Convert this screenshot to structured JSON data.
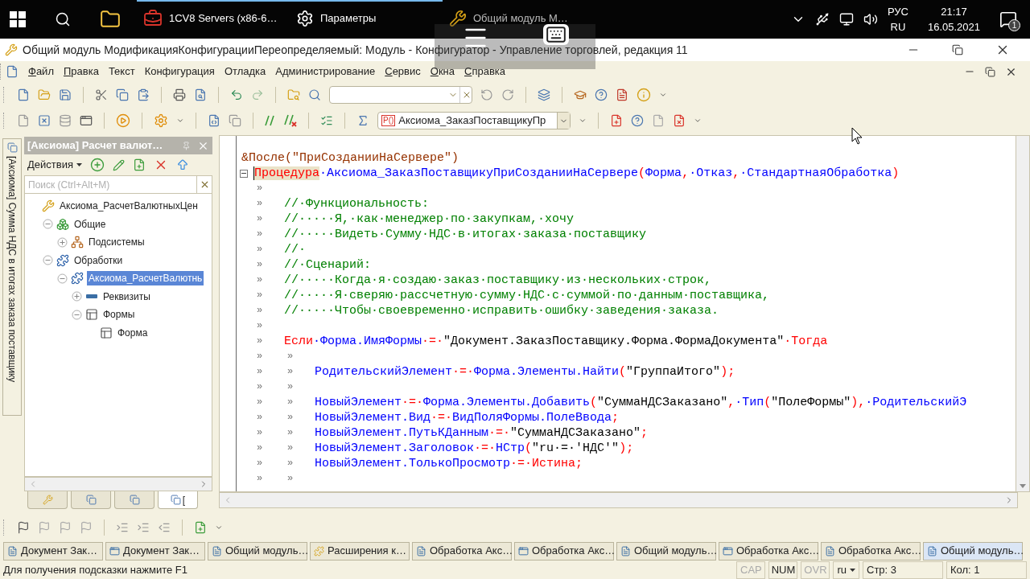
{
  "taskbar": {
    "apps": [
      {
        "kind": "servers",
        "label": "1CV8 Servers (x86-6…",
        "running": true
      },
      {
        "kind": "settings",
        "label": "Параметры",
        "running": true
      },
      {
        "kind": "onec",
        "label": "Общий модуль М…",
        "running": false
      }
    ],
    "tray": {
      "lang_top": "РУС",
      "lang_bottom": "RU",
      "time": "21:17",
      "date": "16.05.2021",
      "notifications": "1"
    }
  },
  "window": {
    "title": "Общий модуль МодификацияКонфигурацииПереопределяемый: Модуль - Конфигуратор - Управление торговлей, редакция 11"
  },
  "menu": [
    {
      "label": "Файл",
      "accel": true
    },
    {
      "label": "Правка",
      "accel": true
    },
    {
      "label": "Текст",
      "accel": false
    },
    {
      "label": "Конфигурация",
      "accel": false
    },
    {
      "label": "Отладка",
      "accel": false
    },
    {
      "label": "Администрирование",
      "accel": false
    },
    {
      "label": "Сервис",
      "accel": true
    },
    {
      "label": "Окна",
      "accel": true
    },
    {
      "label": "Справка",
      "accel": true
    }
  ],
  "procedure_selector": {
    "value": "Аксиома_ЗаказПоставщикуПр",
    "badge": "P()"
  },
  "side_tab": {
    "label": "[Аксиома] Сумма НДС в итогах заказа поставщику"
  },
  "panel": {
    "title": "[Аксиома] Расчет валют…",
    "actions": "Действия",
    "search": {
      "placeholder": "Поиск (Ctrl+Alt+M)"
    },
    "tree": [
      {
        "label": "Аксиома_РасчетВалютныхЦен",
        "kind": "configuration",
        "selected": false,
        "children": [
          {
            "label": "Общие",
            "kind": "common",
            "expanded": true,
            "selected": false,
            "children": [
              {
                "label": "Подсистемы",
                "kind": "subsystems",
                "expanded": false,
                "selected": false
              }
            ]
          },
          {
            "label": "Обработки",
            "kind": "processors",
            "expanded": true,
            "selected": false,
            "children": [
              {
                "label": "Аксиома_РасчетВалютнь",
                "kind": "processor",
                "expanded": true,
                "selected": true,
                "children": [
                  {
                    "label": "Реквизиты",
                    "kind": "attributes",
                    "expanded": false,
                    "selected": false
                  },
                  {
                    "label": "Формы",
                    "kind": "forms",
                    "expanded": true,
                    "selected": false,
                    "children": [
                      {
                        "label": "Форма",
                        "kind": "form",
                        "selected": false
                      }
                    ]
                  }
                ]
              }
            ]
          }
        ]
      }
    ],
    "tabs": [
      {
        "selected": false
      },
      {
        "selected": false
      },
      {
        "selected": false
      },
      {
        "label": "[",
        "selected": true
      }
    ]
  },
  "code": [
    {
      "tokens": [
        {
          "kind": "directive",
          "text": "&После(\"ПриСозданииНаСервере\")"
        }
      ]
    },
    {
      "fold": true,
      "tokens": [
        {
          "kind": "keyword",
          "text": "Процедура",
          "highlight": true
        },
        {
          "kind": "ident",
          "text": "·Аксиома_ЗаказПоставщикуПриСозданииНаСервере"
        },
        {
          "kind": "op",
          "text": "("
        },
        {
          "kind": "ident",
          "text": "Форма"
        },
        {
          "kind": "op",
          "text": ","
        },
        {
          "kind": "ident",
          "text": "·Отказ"
        },
        {
          "kind": "op",
          "text": ","
        },
        {
          "kind": "ident",
          "text": "·СтандартнаяОбработка"
        },
        {
          "kind": "op",
          "text": ")"
        }
      ]
    },
    {
      "tabs": [
        "»"
      ]
    },
    {
      "tabs": [
        "»"
      ],
      "tokens": [
        {
          "kind": "comment",
          "text": "//·Функциональность:"
        }
      ]
    },
    {
      "tabs": [
        "»"
      ],
      "tokens": [
        {
          "kind": "comment",
          "text": "//·····Я,·как·менеджер·по·закупкам,·хочу"
        }
      ]
    },
    {
      "tabs": [
        "»"
      ],
      "tokens": [
        {
          "kind": "comment",
          "text": "//·····Видеть·Сумму·НДС·в·итогах·заказа·поставщику"
        }
      ]
    },
    {
      "tabs": [
        "»"
      ],
      "tokens": [
        {
          "kind": "comment",
          "text": "//·"
        }
      ]
    },
    {
      "tabs": [
        "»"
      ],
      "tokens": [
        {
          "kind": "comment",
          "text": "//·Сценарий:"
        }
      ]
    },
    {
      "tabs": [
        "»"
      ],
      "tokens": [
        {
          "kind": "comment",
          "text": "//·····Когда·я·создаю·заказ·поставщику·из·нескольких·строк,"
        }
      ]
    },
    {
      "tabs": [
        "»"
      ],
      "tokens": [
        {
          "kind": "comment",
          "text": "//·····Я·сверяю·рассчетную·сумму·НДС·с·суммой·по·данным·поставщика,"
        }
      ]
    },
    {
      "tabs": [
        "»"
      ],
      "tokens": [
        {
          "kind": "comment",
          "text": "//·····Чтобы·своевременно·исправить·ошибку·заведения·заказа."
        }
      ]
    },
    {
      "tabs": [
        "»"
      ]
    },
    {
      "tabs": [
        "»"
      ],
      "tokens": [
        {
          "kind": "keyword",
          "text": "Если"
        },
        {
          "kind": "ident",
          "text": "·Форма.ИмяФормы"
        },
        {
          "kind": "op",
          "text": "·=·"
        },
        {
          "kind": "string",
          "text": "\"Документ.ЗаказПоставщику.Форма.ФормаДокумента\""
        },
        {
          "kind": "keyword",
          "text": "·Тогда"
        }
      ]
    },
    {
      "tabs": [
        "»",
        "»"
      ]
    },
    {
      "tabs": [
        "»",
        "»"
      ],
      "tokens": [
        {
          "kind": "ident",
          "text": "РодительскийЭлемент"
        },
        {
          "kind": "op",
          "text": "·=·"
        },
        {
          "kind": "ident",
          "text": "Форма.Элементы.Найти"
        },
        {
          "kind": "op",
          "text": "("
        },
        {
          "kind": "string",
          "text": "\"ГруппаИтого\""
        },
        {
          "kind": "op",
          "text": ");"
        }
      ]
    },
    {
      "tabs": [
        "»",
        "»"
      ]
    },
    {
      "tabs": [
        "»",
        "»"
      ],
      "tokens": [
        {
          "kind": "ident",
          "text": "НовыйЭлемент"
        },
        {
          "kind": "op",
          "text": "·=·"
        },
        {
          "kind": "ident",
          "text": "Форма.Элементы.Добавить"
        },
        {
          "kind": "op",
          "text": "("
        },
        {
          "kind": "string",
          "text": "\"СуммаНДСЗаказано\""
        },
        {
          "kind": "op",
          "text": ","
        },
        {
          "kind": "ident",
          "text": "·Тип"
        },
        {
          "kind": "op",
          "text": "("
        },
        {
          "kind": "string",
          "text": "\"ПолеФормы\""
        },
        {
          "kind": "op",
          "text": "),"
        },
        {
          "kind": "ident",
          "text": "·РодительскийЭ"
        }
      ]
    },
    {
      "tabs": [
        "»",
        "»"
      ],
      "tokens": [
        {
          "kind": "ident",
          "text": "НовыйЭлемент.Вид"
        },
        {
          "kind": "op",
          "text": "·=·"
        },
        {
          "kind": "ident",
          "text": "ВидПоляФормы.ПолеВвода"
        },
        {
          "kind": "op",
          "text": ";"
        }
      ]
    },
    {
      "tabs": [
        "»",
        "»"
      ],
      "tokens": [
        {
          "kind": "ident",
          "text": "НовыйЭлемент.ПутьКДанным"
        },
        {
          "kind": "op",
          "text": "·=·"
        },
        {
          "kind": "string",
          "text": "\"СуммаНДСЗаказано\""
        },
        {
          "kind": "op",
          "text": ";"
        }
      ]
    },
    {
      "tabs": [
        "»",
        "»"
      ],
      "tokens": [
        {
          "kind": "ident",
          "text": "НовыйЭлемент.Заголовок"
        },
        {
          "kind": "op",
          "text": "·=·"
        },
        {
          "kind": "ident",
          "text": "НСтр"
        },
        {
          "kind": "op",
          "text": "("
        },
        {
          "kind": "string",
          "text": "\"ru·=·'НДС'\""
        },
        {
          "kind": "op",
          "text": ");"
        }
      ]
    },
    {
      "tabs": [
        "»",
        "»"
      ],
      "tokens": [
        {
          "kind": "ident",
          "text": "НовыйЭлемент.ТолькоПросмотр"
        },
        {
          "kind": "op",
          "text": "·=·"
        },
        {
          "kind": "keyword",
          "text": "Истина"
        },
        {
          "kind": "op",
          "text": ";"
        }
      ]
    },
    {
      "tabs": [
        "»",
        "»"
      ]
    }
  ],
  "window_tabs": [
    {
      "kind": "module",
      "label": "Документ Зак…",
      "selected": false
    },
    {
      "kind": "form",
      "label": "Документ Зак…",
      "selected": false
    },
    {
      "kind": "module",
      "label": "Общий модуль…",
      "selected": false
    },
    {
      "kind": "extension",
      "label": "Расширения к…",
      "selected": false
    },
    {
      "kind": "module",
      "label": "Обработка Акс…",
      "selected": false
    },
    {
      "kind": "form",
      "label": "Обработка Акс…",
      "selected": false
    },
    {
      "kind": "module",
      "label": "Общий модуль…",
      "selected": false
    },
    {
      "kind": "form",
      "label": "Обработка Акс…",
      "selected": false
    },
    {
      "kind": "module",
      "label": "Обработка Акс…",
      "selected": false
    },
    {
      "kind": "module",
      "label": "Общий модуль…",
      "selected": true
    }
  ],
  "status_bar": {
    "hint": "Для получения подсказки нажмите F1",
    "indicators": [
      {
        "label": "CAP",
        "on": false
      },
      {
        "label": "NUM",
        "on": true
      },
      {
        "label": "OVR",
        "on": false
      }
    ],
    "lang": "ru",
    "line": "Стр: 3",
    "column": "Кол: 1"
  }
}
